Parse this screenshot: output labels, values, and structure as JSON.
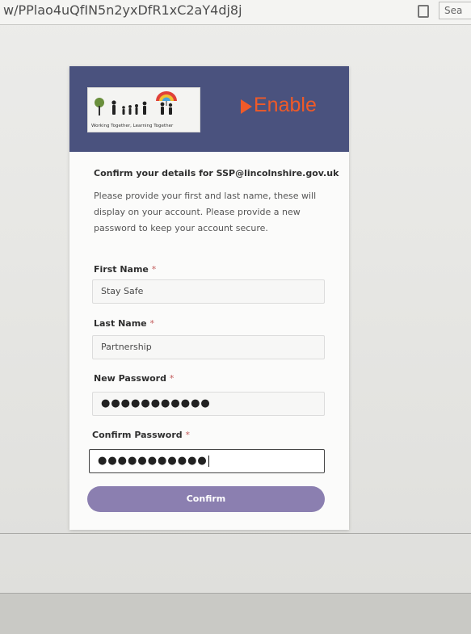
{
  "browser": {
    "url": "w/PPlao4uQfIN5n2yxDfR1xC2aY4dj8j",
    "right_fragment": "Sea"
  },
  "header": {
    "logo_tagline": "Working Together, Learning Together",
    "brand": "Enable",
    "brand_color": "#f05a28",
    "header_color": "#4a527e"
  },
  "form": {
    "heading": "Confirm your details for SSP@lincolnshire.gov.uk",
    "intro": "Please provide your first and last name, these will display on your account. Please provide a new password to keep your account secure.",
    "required_mark": "*",
    "first_name": {
      "label": "First Name",
      "value": "Stay Safe"
    },
    "last_name": {
      "label": "Last Name",
      "value": "Partnership"
    },
    "new_password": {
      "label": "New Password",
      "value": "●●●●●●●●●●●"
    },
    "confirm_password": {
      "label": "Confirm Password",
      "value": "●●●●●●●●●●●"
    },
    "submit_label": "Confirm",
    "button_color": "#8b7fb0"
  }
}
